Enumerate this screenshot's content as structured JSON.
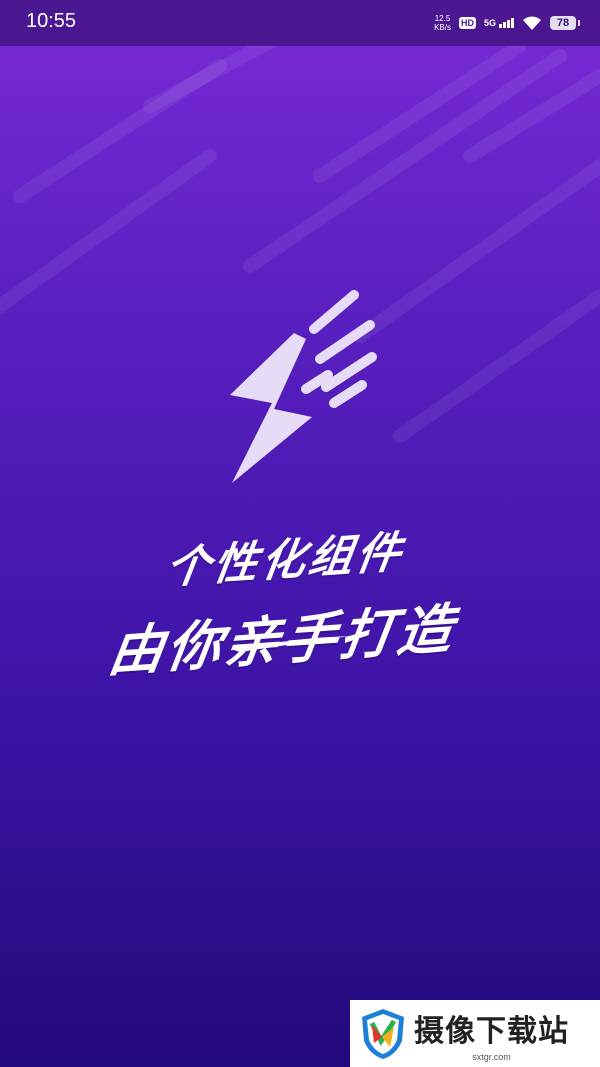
{
  "status_bar": {
    "time": "10:55",
    "net_speed_value": "12.5",
    "net_speed_unit": "KB/s",
    "hd_label": "HD",
    "network_label": "5G",
    "battery_level": "78"
  },
  "splash": {
    "slogan_line1": "个性化组件",
    "slogan_line2": "由你亲手打造"
  },
  "watermark": {
    "title": "摄像下载站",
    "subtitle": "sxtgr.com"
  },
  "colors": {
    "bg_top": "#7a2ad6",
    "bg_bottom": "#230a7c",
    "logo_fill": "#e7dcf7",
    "text": "#ffffff"
  },
  "icons": [
    "lightning-bolt-logo-icon",
    "wifi-icon",
    "signal-icon",
    "battery-icon",
    "hd-icon",
    "shield-logo-icon"
  ]
}
